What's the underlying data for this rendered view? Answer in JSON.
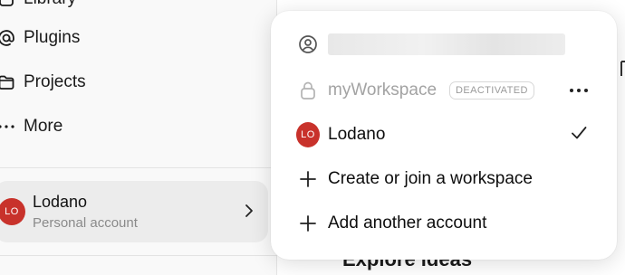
{
  "sidebar": {
    "nav": [
      {
        "label": "Library",
        "icon": "library-icon"
      },
      {
        "label": "Plugins",
        "icon": "at-icon"
      },
      {
        "label": "Projects",
        "icon": "folder-icon"
      },
      {
        "label": "More",
        "icon": "more-dots-icon"
      }
    ],
    "account": {
      "initials": "LO",
      "name": "Lodano",
      "subtitle": "Personal account"
    }
  },
  "main": {
    "heading": "Explore ideas"
  },
  "menu": {
    "email_redacted": "",
    "workspace": {
      "name": "myWorkspace",
      "badge": "DEACTIVATED"
    },
    "current_account": {
      "initials": "LO",
      "name": "Lodano"
    },
    "create_join": "Create or join a workspace",
    "add_account": "Add another account"
  },
  "colors": {
    "avatar": "#c8322b",
    "popup_bg": "#ffffff",
    "sidebar_bg": "#f9f9f9"
  }
}
